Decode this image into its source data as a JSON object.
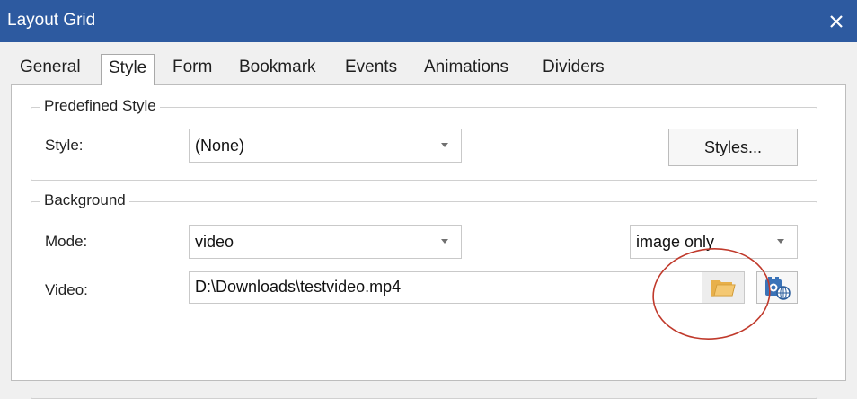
{
  "window": {
    "title": "Layout Grid",
    "close_icon": "close-icon"
  },
  "tabs": [
    {
      "label": "General",
      "active": false
    },
    {
      "label": "Style",
      "active": true
    },
    {
      "label": "Form",
      "active": false
    },
    {
      "label": "Bookmark",
      "active": false
    },
    {
      "label": "Events",
      "active": false
    },
    {
      "label": "Animations",
      "active": false
    },
    {
      "label": "Dividers",
      "active": false
    }
  ],
  "predefined_style": {
    "legend": "Predefined Style",
    "style_label": "Style:",
    "style_value": "(None)",
    "styles_button": "Styles..."
  },
  "background": {
    "legend": "Background",
    "mode_label": "Mode:",
    "mode_value": "video",
    "image_option_value": "image only",
    "video_label": "Video:",
    "video_value": "D:\\Downloads\\testvideo.mp4",
    "browse_icon": "folder-icon",
    "online_icon": "online-video-icon"
  },
  "colors": {
    "titlebar": "#2d5aa0",
    "annotation": "#c0392b",
    "folder": "#e8b04a"
  }
}
